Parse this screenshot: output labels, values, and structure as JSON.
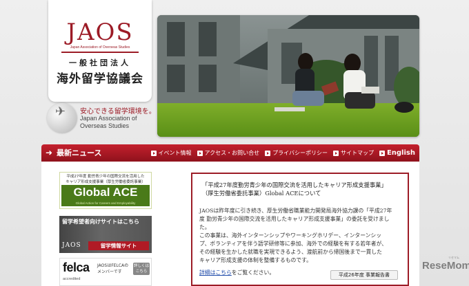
{
  "logo": {
    "brand": "JAOS",
    "english_name": "Japan Association of Overseas Studies",
    "jp_line1": "一般社団法人",
    "jp_line2": "海外留学協議会"
  },
  "tagline": {
    "main": "安心できる留学環境を。",
    "en_line1": "Japan Association of",
    "en_line2": "Overseas Studies"
  },
  "navbar": {
    "news_title": "最新ニュース",
    "items": [
      {
        "label": "イベント情報"
      },
      {
        "label": "アクセス・お問い合せ"
      },
      {
        "label": "プライバシーポリシー"
      },
      {
        "label": "サイトマップ"
      },
      {
        "label": "English"
      }
    ]
  },
  "banners": {
    "ace": {
      "line1": "平成27年度 勤労青少年の国際交流を活用した",
      "line2": "キャリア形成支援事業（厚生労働省委託事業）",
      "title": "Global ACE",
      "subtitle": "Global Action for Careers and Employability"
    },
    "ryugaku": {
      "top_text": "留学希望者向けサイトはこちら",
      "jaos": "JAOS",
      "button": "留学情報サイト"
    },
    "felca": {
      "logo": "felca",
      "accredited": "accredited",
      "text": "JAOSはFELCAのメンバーです",
      "button": "詳しくはこちら"
    }
  },
  "notice": {
    "title1": "「平成27年度勤労青少年の国際交流を活用したキャリア形成支援事業」",
    "title2": "（厚生労働省委託事業）Global ACEについて",
    "title3": "",
    "body": [
      "JAOSは昨年度に引き続き、厚生労働省職業能力開発局海外協力課の「平成27年",
      "度 勤労青少年の国際交流を活用したキャリア形成支援事業」の委託を受けまし",
      "た。",
      "この事業は、海外インターンシップやワーキングホリデー、インターンシッ",
      "プ、ボランティアを伴う語学研修等に参加、海外での経験を有する若年者が、",
      "その経験を生かした就職を実現できるよう、渡航前から帰国後まで一貫した",
      "キャリア形成支援の体制を整備するものです。"
    ],
    "link_text": "詳細はこちら",
    "link_suffix": "をご覧ください。",
    "report_button": "平成26年度 事業報告書"
  },
  "watermark": {
    "text": "ReseMom",
    "kana": "リセマム"
  }
}
